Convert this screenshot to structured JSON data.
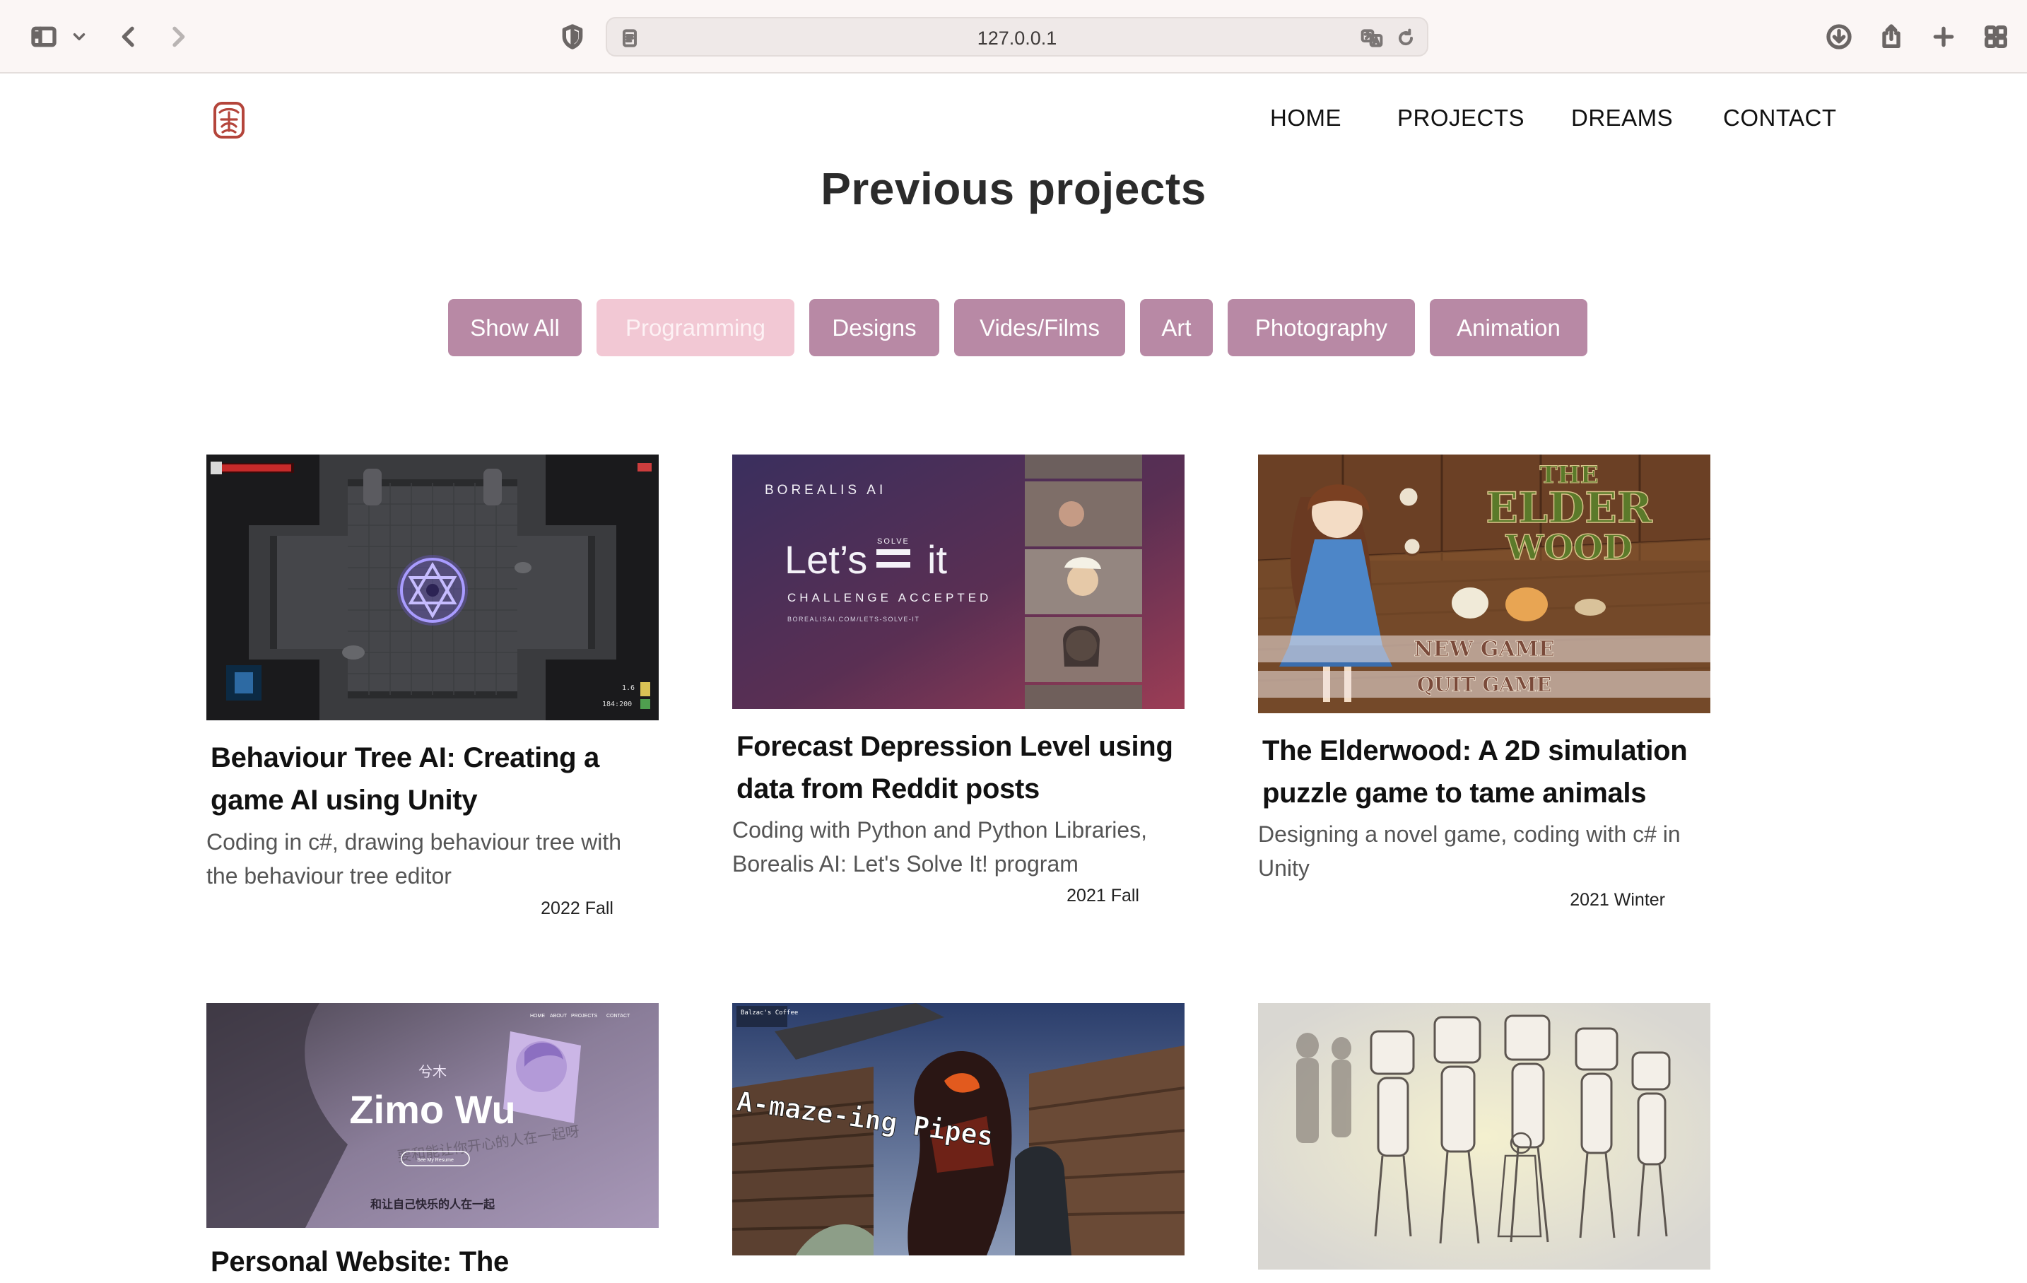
{
  "browser": {
    "address": "127.0.0.1",
    "icons": [
      "sidebar-icon",
      "chevron-down-icon",
      "back-icon",
      "forward-icon",
      "privacy-shield-icon",
      "page-icon",
      "translate-icon",
      "reload-icon",
      "download-icon",
      "share-icon",
      "new-tab-icon",
      "tab-overview-icon"
    ]
  },
  "nav": {
    "items": [
      {
        "label": "HOME"
      },
      {
        "label": "PROJECTS"
      },
      {
        "label": "DREAMS"
      },
      {
        "label": "CONTACT"
      }
    ]
  },
  "page": {
    "title": "Previous projects"
  },
  "filters": [
    {
      "label": "Show All",
      "active": false
    },
    {
      "label": "Programming",
      "active": true
    },
    {
      "label": "Designs",
      "active": false
    },
    {
      "label": "Vides/Films",
      "active": false
    },
    {
      "label": "Art",
      "active": false
    },
    {
      "label": "Photography",
      "active": false
    },
    {
      "label": "Animation",
      "active": false
    }
  ],
  "projects": [
    {
      "title": "Behaviour Tree AI: Creating a game AI using Unity",
      "description": "Coding in c#, drawing behaviour tree with the behaviour tree editor",
      "date": "2022 Fall",
      "image_text": {
        "hud": "1.6",
        "score": "184:200"
      }
    },
    {
      "title": "Forecast Depression Level using data from Reddit posts",
      "description": "Coding with Python and Python Libraries, Borealis AI: Let's Solve It! program",
      "date": "2021 Fall",
      "image_text": {
        "brand": "BOREALIS AI",
        "headline_a": "Let’s",
        "headline_small": "SOLVE",
        "headline_b": "it",
        "tagline": "CHALLENGE ACCEPTED",
        "url": "BOREALISAI.COM/LETS-SOLVE-IT"
      }
    },
    {
      "title": "The Elderwood: A 2D simulation puzzle game to tame animals",
      "description": "Designing a novel game, coding with c# in Unity",
      "date": "2021 Winter",
      "image_text": {
        "title_line1": "THE",
        "title_line2": "ELDER",
        "title_line3": "WOOD",
        "menu1": "NEW GAME",
        "menu2": "QUIT GAME"
      }
    },
    {
      "title": "Personal Website: The",
      "description": "",
      "date": "",
      "image_text": {
        "name": "Zimo Wu",
        "small_name": "兮木",
        "tagline": "要和能让你开心的人在一起呀",
        "button": "See My Resume",
        "bottom": "和让自己快乐的人在一起",
        "nav": [
          "HOME",
          "ABOUT",
          "PROJECTS",
          "CONTACT"
        ]
      }
    },
    {
      "title": "",
      "description": "",
      "date": "",
      "image_text": {
        "corner": "Balzac's Coffee",
        "sign": "A-maze-ing Pipes"
      }
    },
    {
      "title": "",
      "description": "",
      "date": "",
      "image_text": {}
    }
  ]
}
